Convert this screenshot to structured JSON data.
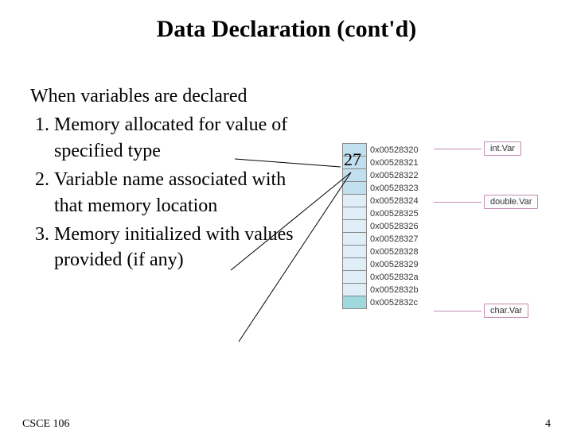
{
  "title": "Data Declaration (cont'd)",
  "intro": "When variables are declared",
  "items": [
    "Memory allocated for value of specified type",
    "Variable name associated with that memory location",
    "Memory initialized with values provided (if any)"
  ],
  "footer": {
    "left": "CSCE 106",
    "right": "4"
  },
  "memory": {
    "value": "27",
    "addresses": [
      "0x00528320",
      "0x00528321",
      "0x00528322",
      "0x00528323",
      "0x00528324",
      "0x00528325",
      "0x00528326",
      "0x00528327",
      "0x00528328",
      "0x00528329",
      "0x0052832a",
      "0x0052832b",
      "0x0052832c"
    ],
    "labels": {
      "intVar": "int.Var",
      "doubleVar": "double.Var",
      "charVar": "char.Var"
    }
  }
}
